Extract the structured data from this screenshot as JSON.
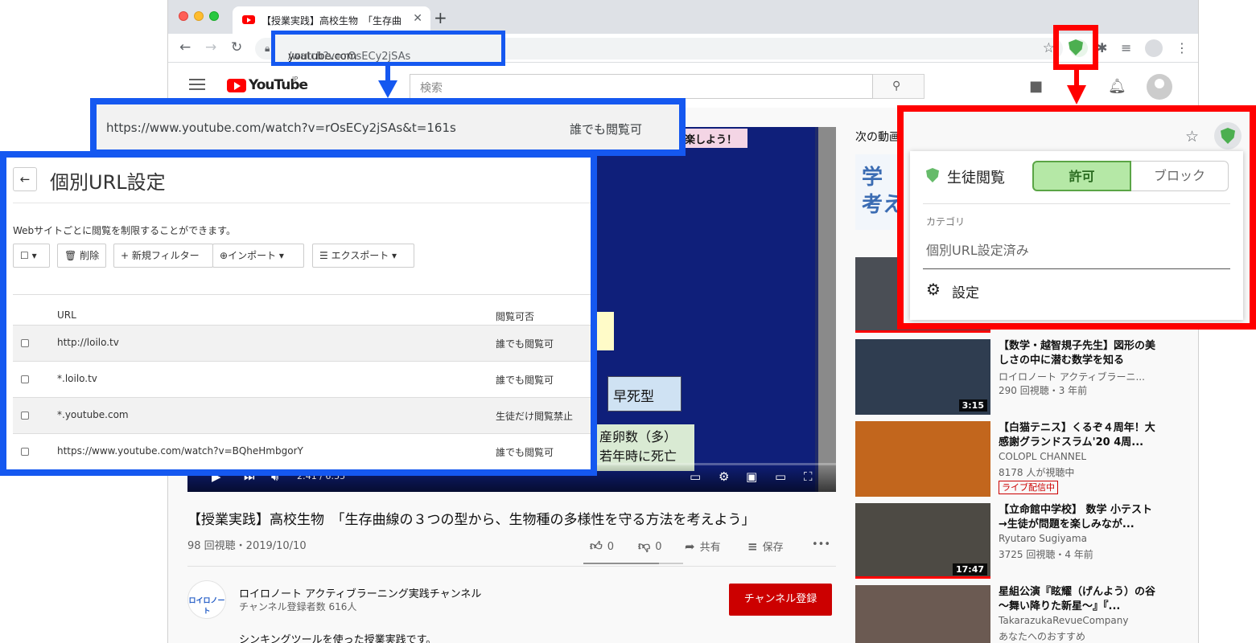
{
  "browser": {
    "tab_title": "【授業実践】高校生物　「生存曲",
    "tab_close": "✕",
    "new_tab": "+",
    "url_host": "youtube.com",
    "url_path": "/watch?v=rOsECy2jSAs"
  },
  "youtube": {
    "logo_text": "YouTube",
    "logo_region": "JP",
    "search_placeholder": "検索",
    "player": {
      "slide_banner": "楽しよう！",
      "box1": "早死型",
      "box2_line1": "産卵数（多）",
      "box2_line2": "若年時に死亡",
      "time": "2:41 / 6:55"
    },
    "video_title": "【授業実践】高校生物　「生存曲線の３つの型から、生物種の多様性を守る方法を考えよう」",
    "video_meta": "98 回視聴・2019/10/10",
    "actions": {
      "likes": "0",
      "dislikes": "0",
      "share": "共有",
      "save": "保存",
      "more": "•••"
    },
    "channel": {
      "avatar_text": "ロイロノート",
      "name": "ロイロノート アクティブラーニング実践チャンネル",
      "subscribers": "チャンネル登録者数 616人",
      "subscribe_label": "チャンネル登録"
    },
    "description": "シンキングツールを使った授業実践です。",
    "up_next_label": "次の動画",
    "up_next_thumb_text": "学\n考え",
    "recommendations": [
      {
        "title": "【数学・越智規子先生】図形の美しさの中に潜む数学を知る",
        "channel": "ロイロノート アクティブラーニ...",
        "views": "290 回視聴・3 年前",
        "duration": "3:15"
      },
      {
        "title": "【白猫テニス】くるぞ４周年！大感謝グランドスラム'20 4周...",
        "channel": "COLOPL CHANNEL",
        "views": "8178 人が視聴中",
        "badge": "ライブ配信中"
      },
      {
        "title": "【立命館中学校】 数学 小テスト→生徒が問題を楽しみなが...",
        "channel": "Ryutaro Sugiyama",
        "views": "3725 回視聴・4 年前",
        "duration": "17:47"
      },
      {
        "title": "星組公演『眩耀（げんよう）の谷　～舞い降りた新星～』『...",
        "channel": "TakarazukaRevueCompany",
        "views": "あなたへのおすすめ"
      }
    ]
  },
  "annotation": {
    "url_row": {
      "url": "https://www.youtube.com/watch?v=rOsECy2jSAs&t=161s",
      "status": "誰でも閲覧可"
    },
    "settings_panel": {
      "back_icon": "←",
      "title": "個別URL設定",
      "description": "Webサイトごとに閲覧を制限することができます。",
      "buttons": {
        "select": "☐ ▾",
        "delete": "削除",
        "new_filter": "+ 新規フィルター",
        "import": "インポート ▾",
        "export": "エクスポート ▾"
      },
      "columns": [
        "URL",
        "閲覧可否"
      ],
      "rows": [
        {
          "url": "http://loilo.tv",
          "status": "誰でも閲覧可"
        },
        {
          "url": "*.loilo.tv",
          "status": "誰でも閲覧可"
        },
        {
          "url": "*.youtube.com",
          "status": "生徒だけ閲覧禁止"
        },
        {
          "url": "https://www.youtube.com/watch?v=BQheHmbgorY",
          "status": "誰でも閲覧可"
        }
      ]
    },
    "popup": {
      "label": "生徒閲覧",
      "allow": "許可",
      "block": "ブロック",
      "category_label": "カテゴリ",
      "category_value": "個別URL設定済み",
      "settings": "設定"
    }
  },
  "colors": {
    "annotation_blue": "#1558f0",
    "annotation_red": "#ff0000",
    "allow_green": "#b5e8a6",
    "youtube_red": "#ff0000",
    "subscribe_red": "#cc0000"
  }
}
